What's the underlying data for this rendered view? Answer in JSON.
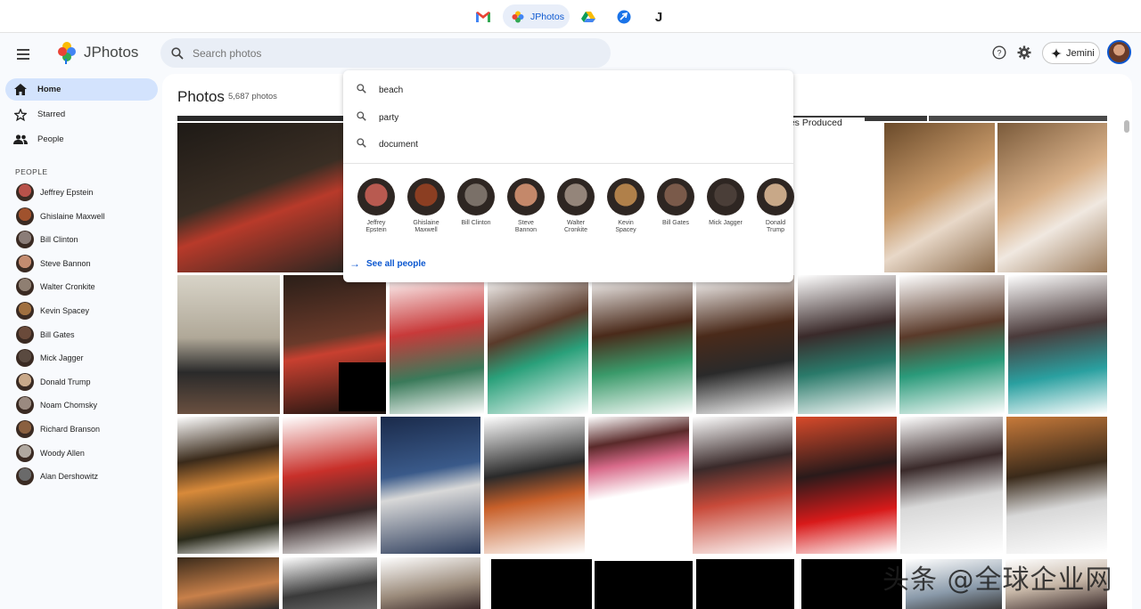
{
  "top_bar": {
    "apps": [
      {
        "name": "gmail-icon"
      },
      {
        "name": "jphotos-icon",
        "label": "JPhotos"
      },
      {
        "name": "drive-icon"
      },
      {
        "name": "flights-icon"
      },
      {
        "name": "j-app-icon",
        "glyph": "J"
      }
    ]
  },
  "header": {
    "brand": "JPhotos",
    "search_placeholder": "Search photos",
    "jemini_label": "Jemini"
  },
  "sidebar": {
    "nav": [
      {
        "label": "Home",
        "icon": "home-icon",
        "active": true
      },
      {
        "label": "Starred",
        "icon": "star-icon",
        "active": false
      },
      {
        "label": "People",
        "icon": "people-icon",
        "active": false
      }
    ],
    "people_heading": "PEOPLE",
    "people": [
      {
        "name": "Jeffrey Epstein",
        "color": "#b8524a"
      },
      {
        "name": "Ghislaine Maxwell",
        "color": "#a0522d"
      },
      {
        "name": "Bill Clinton",
        "color": "#8b7d78"
      },
      {
        "name": "Steve Bannon",
        "color": "#c48c70"
      },
      {
        "name": "Walter Cronkite",
        "color": "#8f7f72"
      },
      {
        "name": "Kevin Spacey",
        "color": "#a07040"
      },
      {
        "name": "Bill Gates",
        "color": "#6a4a3a"
      },
      {
        "name": "Mick Jagger",
        "color": "#5a4a40"
      },
      {
        "name": "Donald Trump",
        "color": "#c9a98a"
      },
      {
        "name": "Noam Chomsky",
        "color": "#9a8a80"
      },
      {
        "name": "Richard Branson",
        "color": "#8a6040"
      },
      {
        "name": "Woody Allen",
        "color": "#b0a8a0"
      },
      {
        "name": "Alan Dershowitz",
        "color": "#6a6a6a"
      }
    ]
  },
  "main": {
    "title": "Photos",
    "count": "5,687 photos",
    "photo_text": "ges Produced"
  },
  "dropdown": {
    "suggestions": [
      "beach",
      "party",
      "document"
    ],
    "faces": [
      {
        "name": "Jeffrey Epstein",
        "line1": "Jeffrey",
        "line2": "Epstein",
        "color": "#b85a50"
      },
      {
        "name": "Ghislaine Maxwell",
        "line1": "Ghislaine",
        "line2": "Maxwell",
        "color": "#8b3e22"
      },
      {
        "name": "Bill Clinton",
        "line1": "Bill Clinton",
        "line2": "",
        "color": "#7a7068"
      },
      {
        "name": "Steve Bannon",
        "line1": "Steve",
        "line2": "Bannon",
        "color": "#c4886a"
      },
      {
        "name": "Walter Cronkite",
        "line1": "Walter",
        "line2": "Cronkite",
        "color": "#94857a"
      },
      {
        "name": "Kevin Spacey",
        "line1": "Kevin",
        "line2": "Spacey",
        "color": "#b0804a"
      },
      {
        "name": "Bill Gates",
        "line1": "Bill Gates",
        "line2": "",
        "color": "#7a5a4a"
      },
      {
        "name": "Mick Jagger",
        "line1": "Mick Jagger",
        "line2": "",
        "color": "#4a3e38"
      },
      {
        "name": "Donald Trump",
        "line1": "Donald",
        "line2": "Trump",
        "color": "#c8a888"
      }
    ],
    "see_all": "See all people"
  },
  "watermark": "头条 @全球企业网"
}
